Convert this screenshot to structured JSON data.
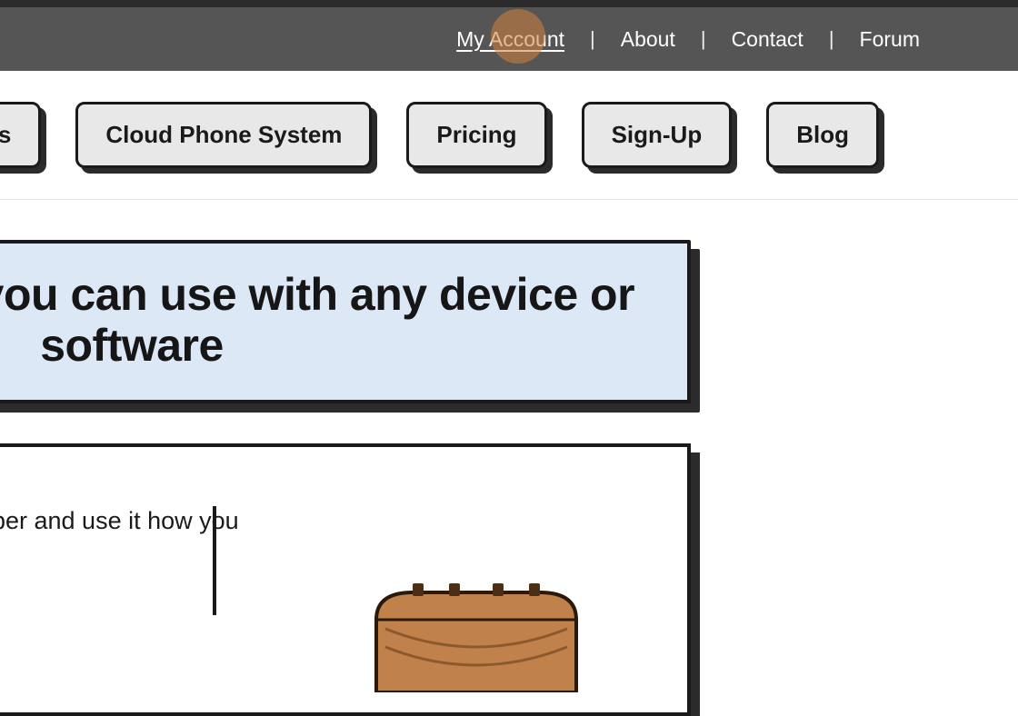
{
  "topnav": {
    "items": [
      {
        "label": "My Account",
        "active": true
      },
      {
        "label": "About",
        "active": false
      },
      {
        "label": "Contact",
        "active": false
      },
      {
        "label": "Forum",
        "active": false
      }
    ]
  },
  "mainnav": {
    "items": [
      {
        "label": "Phone Numbers"
      },
      {
        "label": "Cloud Phone System"
      },
      {
        "label": "Pricing"
      },
      {
        "label": "Sign-Up"
      },
      {
        "label": "Blog"
      }
    ]
  },
  "hero": {
    "title": "Phone numbers you can use with any device or software"
  },
  "body": {
    "text": "Our service is simple, get a number and use it how you want."
  }
}
